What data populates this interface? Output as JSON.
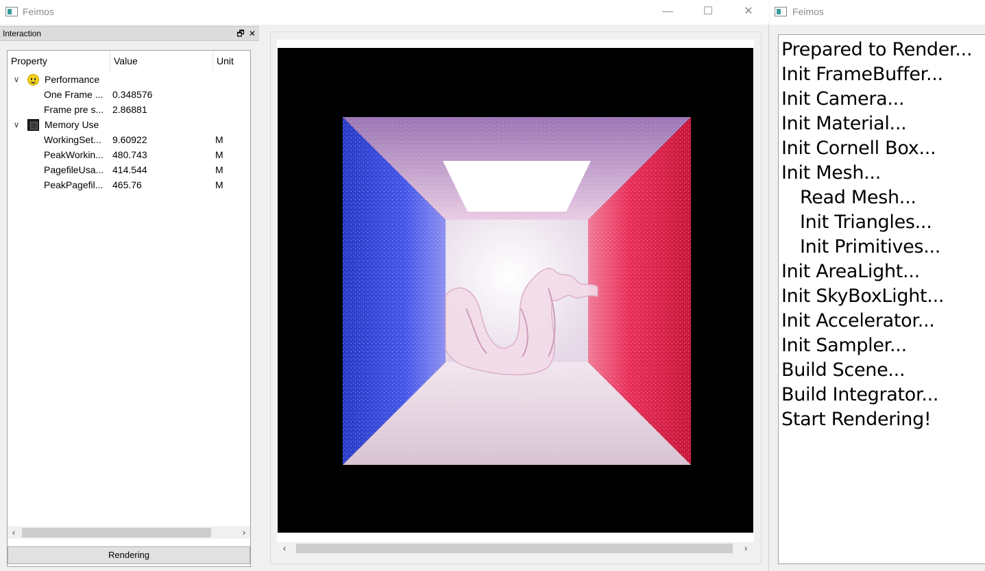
{
  "main_window": {
    "title": "Feimos",
    "controls": {
      "minimize": "—",
      "maximize": "☐",
      "close": "✕"
    }
  },
  "dock": {
    "title": "Interaction",
    "float_glyph": "🗗",
    "close_glyph": "✕",
    "columns": [
      "Property",
      "Value",
      "Unit"
    ],
    "groups": [
      {
        "label": "Performance",
        "icon": "smiley-icon",
        "rows": [
          {
            "property": "One Frame ...",
            "value": "0.348576",
            "unit": ""
          },
          {
            "property": "Frame pre s...",
            "value": "2.86881",
            "unit": ""
          }
        ]
      },
      {
        "label": "Memory Use",
        "icon": "chip-icon",
        "rows": [
          {
            "property": "WorkingSet...",
            "value": "9.60922",
            "unit": "M"
          },
          {
            "property": "PeakWorkin...",
            "value": "480.743",
            "unit": "M"
          },
          {
            "property": "PagefileUsa...",
            "value": "414.544",
            "unit": "M"
          },
          {
            "property": "PeakPagefil...",
            "value": "465.76",
            "unit": "M"
          }
        ]
      }
    ],
    "scroll_left": "‹",
    "scroll_right": "›",
    "render_button": "Rendering"
  },
  "view": {
    "scroll_left": "‹",
    "scroll_right": "›",
    "colors": {
      "left_wall": "#2f3fd6",
      "right_wall": "#e0244a",
      "back_wall": "#f2eaf0"
    }
  },
  "log_window": {
    "title": "Feimos",
    "lines": [
      "Prepared to Render...",
      "Init FrameBuffer...",
      "Init Camera...",
      "Init Material...",
      "Init Cornell Box...",
      "Init Mesh...",
      "Read Mesh...",
      "Init Triangles...",
      "Init Primitives...",
      "Init AreaLight...",
      "Init SkyBoxLight...",
      "Init Accelerator...",
      "Init Sampler...",
      "Build Scene...",
      "Build Integrator...",
      "Start Rendering!"
    ]
  }
}
